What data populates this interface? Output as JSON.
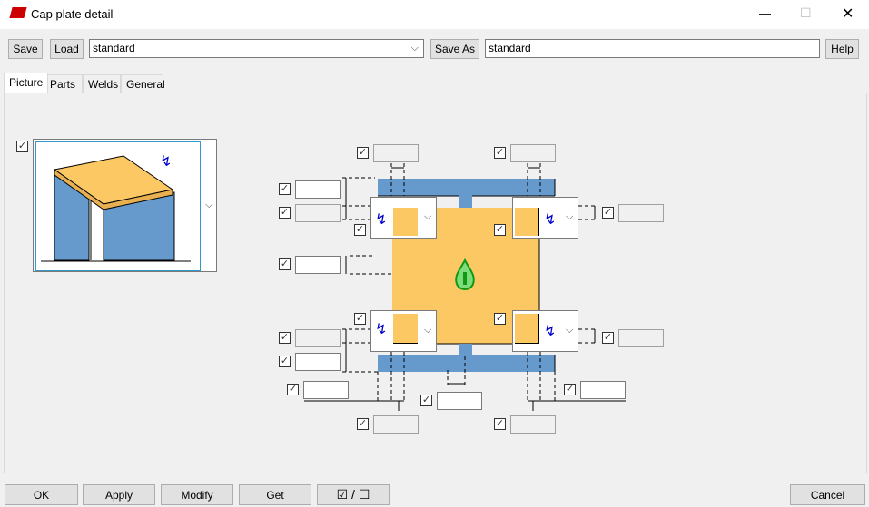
{
  "window": {
    "title": "Cap plate detail",
    "controls": {
      "minimize": "—",
      "maximize": "☐",
      "close": "✕"
    }
  },
  "toolbar": {
    "save": "Save",
    "load": "Load",
    "preset_value": "standard",
    "save_as": "Save As",
    "save_as_value": "standard",
    "help": "Help"
  },
  "tabs": [
    {
      "label": "Picture",
      "active": true
    },
    {
      "label": "Parts"
    },
    {
      "label": "Welds"
    },
    {
      "label": "General"
    }
  ],
  "footer": {
    "ok": "OK",
    "apply": "Apply",
    "modify": "Modify",
    "get": "Get",
    "toggle": "☑ / ☐",
    "cancel": "Cancel"
  },
  "colors": {
    "plate": "#fcc864",
    "profile": "#6699cc",
    "accent": "#0000cc"
  }
}
